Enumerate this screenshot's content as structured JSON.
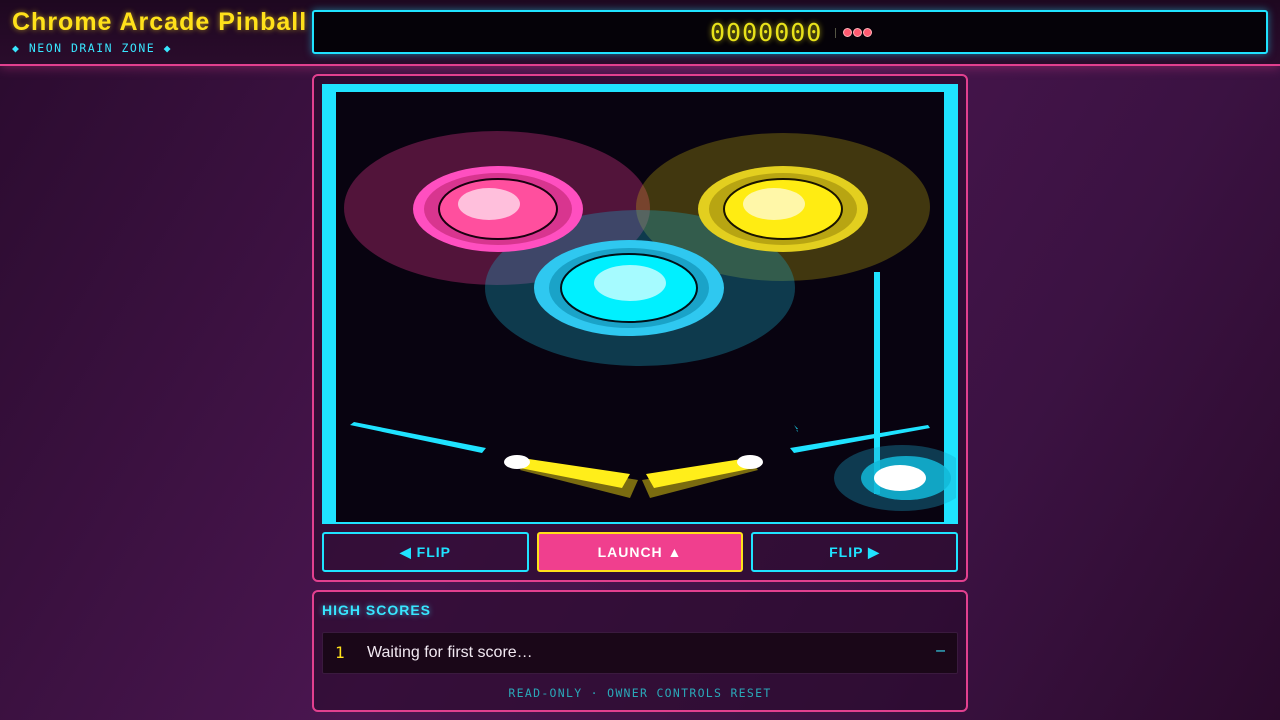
{
  "header": {
    "title": "Chrome Arcade Pinball",
    "subtitle": "◆ NEON DRAIN ZONE ◆",
    "score": "0000000",
    "balls_remaining": 3
  },
  "controls": {
    "flip_left": "◀ FLIP",
    "launch": "LAUNCH ▲",
    "flip_right": "FLIP ▶"
  },
  "high_scores": {
    "title": "HIGH SCORES",
    "rows": [
      {
        "rank": "1",
        "name": "Waiting for first score…",
        "score": "–"
      }
    ],
    "footer": "READ-ONLY · OWNER CONTROLS RESET"
  },
  "colors": {
    "accent_pink": "#f03f8e",
    "accent_cyan": "#1fe3ff",
    "accent_yellow": "#ffe11a"
  }
}
